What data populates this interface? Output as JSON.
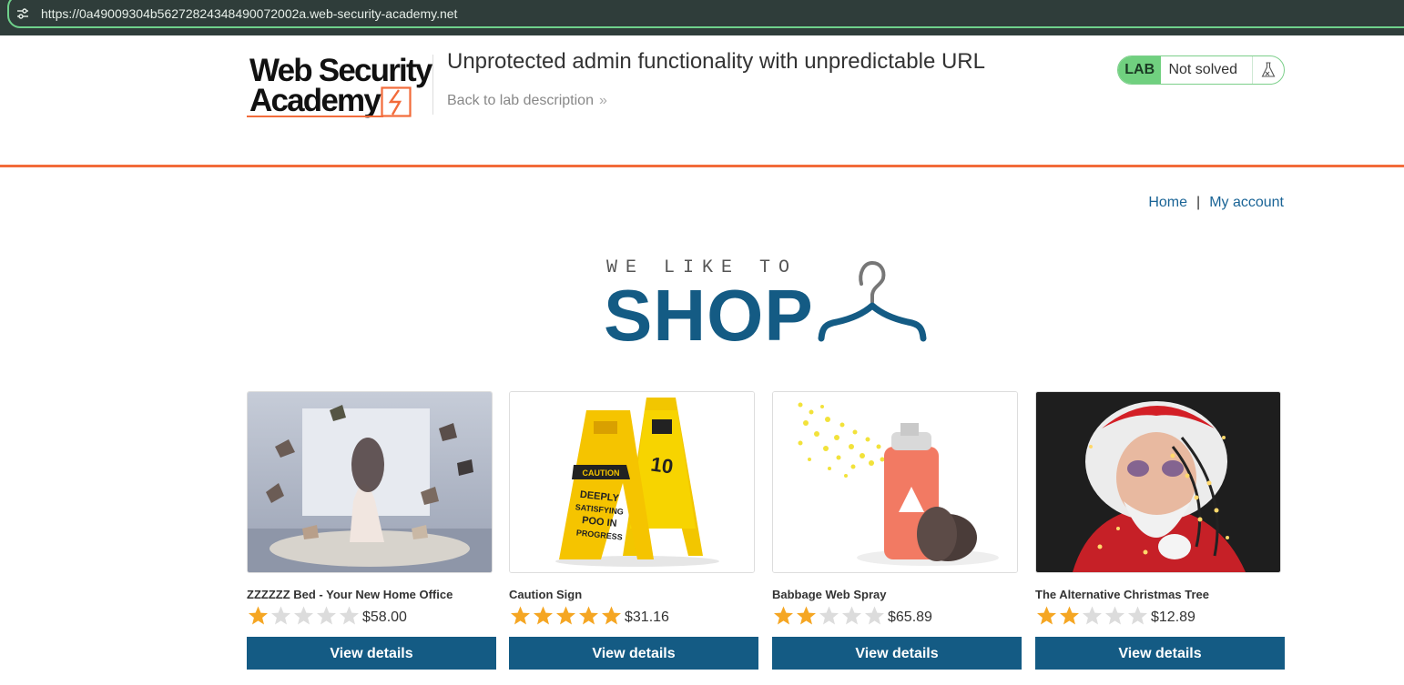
{
  "browser": {
    "url": "https://0a49009304b56272824348490072002a.web-security-academy.net"
  },
  "header": {
    "logo_line1": "Web Security",
    "logo_line2": "Academy",
    "lab_title": "Unprotected admin functionality with unpredictable URL",
    "back_link": "Back to lab description",
    "status_tag": "LAB",
    "status_text": "Not solved"
  },
  "nav": {
    "home": "Home",
    "separator": "|",
    "account": "My account"
  },
  "hero": {
    "small": "WE LIKE TO",
    "big": "SHOP"
  },
  "colors": {
    "accent": "#f26b3a",
    "brand_blue": "#145b84",
    "star": "#f5a623",
    "status_green": "#70d07f"
  },
  "products": [
    {
      "name": "ZZZZZZ Bed - Your New Home Office",
      "rating": 1,
      "price": "$58.00",
      "button": "View details"
    },
    {
      "name": "Caution Sign",
      "rating": 5,
      "price": "$31.16",
      "button": "View details"
    },
    {
      "name": "Babbage Web Spray",
      "rating": 2,
      "price": "$65.89",
      "button": "View details"
    },
    {
      "name": "The Alternative Christmas Tree",
      "rating": 2,
      "price": "$12.89",
      "button": "View details"
    }
  ]
}
